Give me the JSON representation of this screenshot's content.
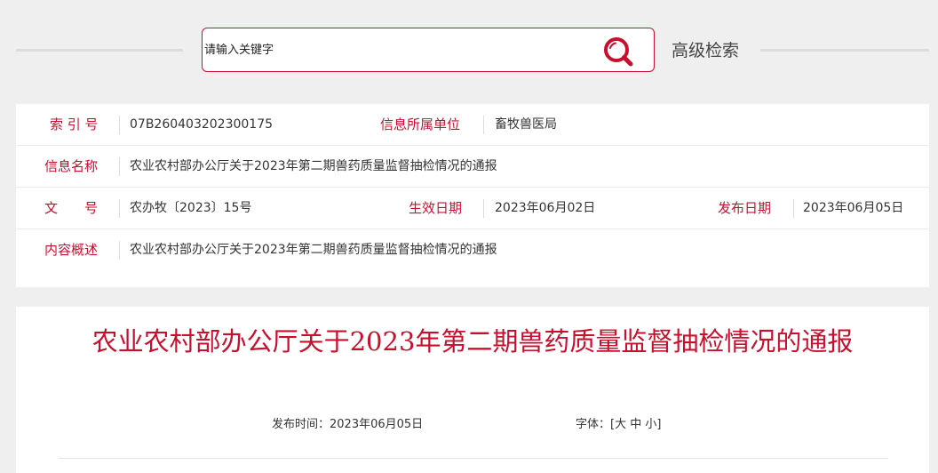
{
  "search": {
    "placeholder": "请输入关键字",
    "advanced_label": "高级检索"
  },
  "meta": {
    "index_label": "索 引 号",
    "index_value": "07B260403202300175",
    "unit_label": "信息所属单位",
    "unit_value": "畜牧兽医局",
    "name_label": "信息名称",
    "name_value": "农业农村部办公厅关于2023年第二期兽药质量监督抽检情况的通报",
    "docno_label": "文　　号",
    "docno_value": "农办牧〔2023〕15号",
    "effective_label": "生效日期",
    "effective_value": "2023年06月02日",
    "publish_label": "发布日期",
    "publish_value": "2023年06月05日",
    "summary_label": "内容概述",
    "summary_value": "农业农村部办公厅关于2023年第二期兽药质量监督抽检情况的通报"
  },
  "article": {
    "title": "农业农村部办公厅关于2023年第二期兽药质量监督抽检情况的通报",
    "publish_time_label": "发布时间：",
    "publish_time_value": "2023年06月05日",
    "font_label": "字体：",
    "font_open": "[",
    "font_large": "大",
    "font_medium": "中",
    "font_small": "小",
    "font_close": "]"
  },
  "colors": {
    "accent": "#c8102e",
    "background": "#efefef",
    "panel": "#ffffff"
  },
  "icons": {
    "search": "search-icon"
  }
}
